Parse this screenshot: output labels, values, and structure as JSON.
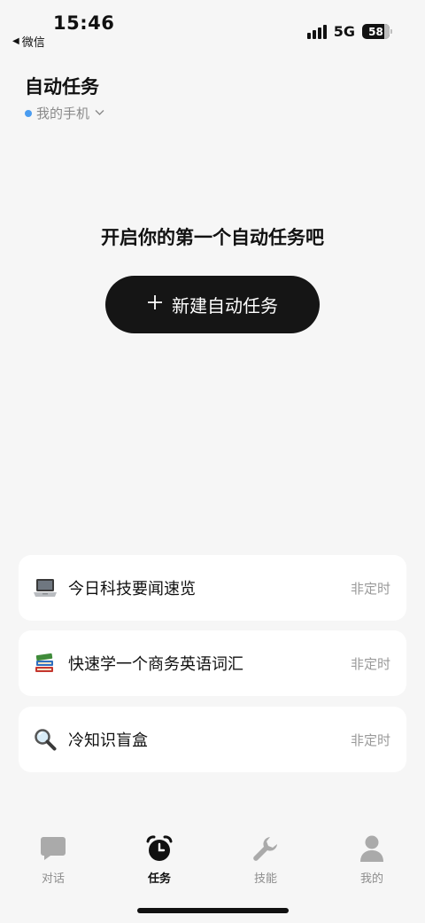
{
  "status_bar": {
    "time": "15:46",
    "back_label": "微信",
    "network": "5G",
    "battery": "58"
  },
  "header": {
    "title": "自动任务",
    "device": "我的手机"
  },
  "empty_state": {
    "heading": "开启你的第一个自动任务吧",
    "button_label": "新建自动任务"
  },
  "templates": [
    {
      "icon": "laptop-icon",
      "title": "今日科技要闻速览",
      "schedule": "非定时"
    },
    {
      "icon": "books-icon",
      "title": "快速学一个商务英语词汇",
      "schedule": "非定时"
    },
    {
      "icon": "magnifier-icon",
      "title": "冷知识盲盒",
      "schedule": "非定时"
    }
  ],
  "tab_bar": {
    "items": [
      {
        "label": "对话",
        "icon": "chat-bubble-icon",
        "active": false
      },
      {
        "label": "任务",
        "icon": "alarm-clock-icon",
        "active": true
      },
      {
        "label": "技能",
        "icon": "wrench-icon",
        "active": false
      },
      {
        "label": "我的",
        "icon": "person-icon",
        "active": false
      }
    ]
  },
  "colors": {
    "background": "#f6f6f6",
    "card": "#ffffff",
    "primary_button": "#151515",
    "device_dot": "#4a9cf0",
    "muted_text": "#9a9a9a",
    "inactive_tab": "#aaaaaa"
  }
}
